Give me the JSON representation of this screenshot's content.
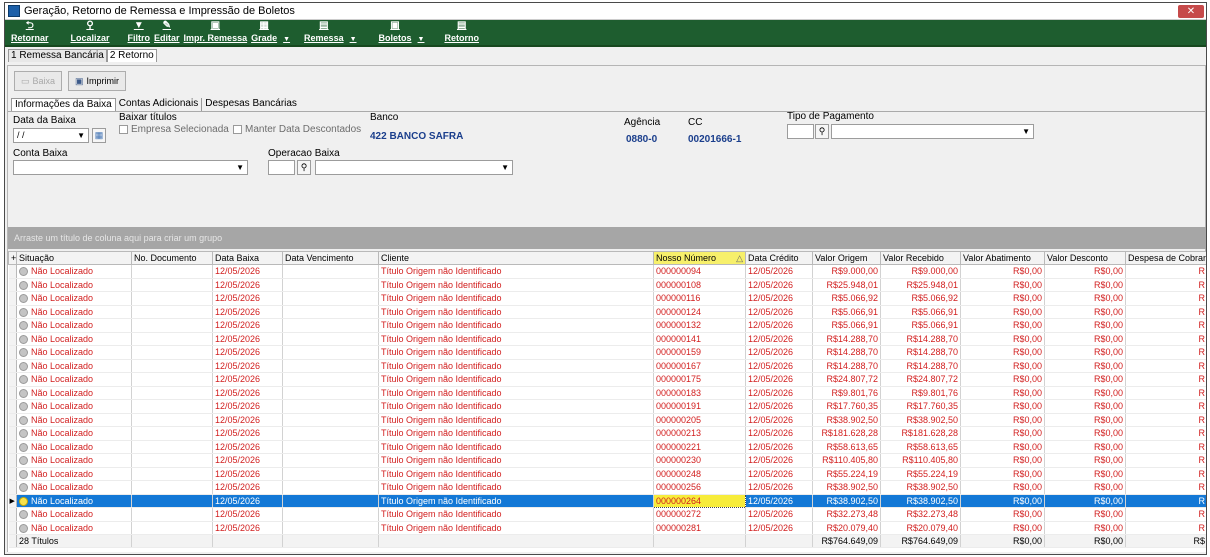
{
  "window": {
    "title": "Geração, Retorno de Remessa e Impressão de Boletos",
    "close": "✕"
  },
  "toolbar": {
    "retornar": "Retornar",
    "localizar": "Localizar",
    "filtro": "Filtro",
    "editar": "Editar",
    "impr_remessa": "Impr. Remessa",
    "grade": "Grade",
    "remessa": "Remessa",
    "boletos": "Boletos",
    "retorno": "Retorno"
  },
  "main_tabs": [
    "1 Remessa Bancária",
    "2 Retorno"
  ],
  "buttons": {
    "baixa": "Baixa",
    "imprimir": "Imprimir"
  },
  "sub_tabs": [
    "Informações da Baixa",
    "Contas Adicionais",
    "Despesas Bancárias"
  ],
  "form": {
    "data_baixa_label": "Data da Baixa",
    "data_baixa_value": " / /",
    "baixar_titulos_label": "Baixar títulos",
    "empresa_selecionada": "Empresa Selecionada",
    "manter_data": "Manter Data Descontados",
    "banco_label": "Banco",
    "banco_value": "422 BANCO SAFRA",
    "agencia_label": "Agência",
    "agencia_value": "0880-0",
    "cc_label": "CC",
    "cc_value": "00201666-1",
    "tipo_pagamento_label": "Tipo de Pagamento",
    "conta_baixa_label": "Conta Baixa",
    "operacao_baixa_label": "Operacao Baixa"
  },
  "group_area_text": "Arraste um título de coluna aqui para criar um grupo",
  "grid": {
    "columns": [
      "Situação",
      "No. Documento",
      "Data Baixa",
      "Data Vencimento",
      "Cliente",
      "Nosso Número",
      "Data Crédito",
      "Valor Origem",
      "Valor Recebido",
      "Valor Abatimento",
      "Valor Desconto",
      "Despesa de Cobrança"
    ],
    "sort_indicator": "△",
    "rows": [
      {
        "situacao": "Não Localizado",
        "doc": "",
        "data_baixa": "12/05/2026",
        "venc": "",
        "cliente": "Título Origem não Identificado",
        "nosso": "000000094",
        "credito": "12/05/2026",
        "origem": "R$9.000,00",
        "recebido": "R$9.000,00",
        "abat": "R$0,00",
        "desc": "R$0,00",
        "desp": "R"
      },
      {
        "situacao": "Não Localizado",
        "doc": "",
        "data_baixa": "12/05/2026",
        "venc": "",
        "cliente": "Título Origem não Identificado",
        "nosso": "000000108",
        "credito": "12/05/2026",
        "origem": "R$25.948,01",
        "recebido": "R$25.948,01",
        "abat": "R$0,00",
        "desc": "R$0,00",
        "desp": "R"
      },
      {
        "situacao": "Não Localizado",
        "doc": "",
        "data_baixa": "12/05/2026",
        "venc": "",
        "cliente": "Título Origem não Identificado",
        "nosso": "000000116",
        "credito": "12/05/2026",
        "origem": "R$5.066,92",
        "recebido": "R$5.066,92",
        "abat": "R$0,00",
        "desc": "R$0,00",
        "desp": "R"
      },
      {
        "situacao": "Não Localizado",
        "doc": "",
        "data_baixa": "12/05/2026",
        "venc": "",
        "cliente": "Título Origem não Identificado",
        "nosso": "000000124",
        "credito": "12/05/2026",
        "origem": "R$5.066,91",
        "recebido": "R$5.066,91",
        "abat": "R$0,00",
        "desc": "R$0,00",
        "desp": "R"
      },
      {
        "situacao": "Não Localizado",
        "doc": "",
        "data_baixa": "12/05/2026",
        "venc": "",
        "cliente": "Título Origem não Identificado",
        "nosso": "000000132",
        "credito": "12/05/2026",
        "origem": "R$5.066,91",
        "recebido": "R$5.066,91",
        "abat": "R$0,00",
        "desc": "R$0,00",
        "desp": "R"
      },
      {
        "situacao": "Não Localizado",
        "doc": "",
        "data_baixa": "12/05/2026",
        "venc": "",
        "cliente": "Título Origem não Identificado",
        "nosso": "000000141",
        "credito": "12/05/2026",
        "origem": "R$14.288,70",
        "recebido": "R$14.288,70",
        "abat": "R$0,00",
        "desc": "R$0,00",
        "desp": "R"
      },
      {
        "situacao": "Não Localizado",
        "doc": "",
        "data_baixa": "12/05/2026",
        "venc": "",
        "cliente": "Título Origem não Identificado",
        "nosso": "000000159",
        "credito": "12/05/2026",
        "origem": "R$14.288,70",
        "recebido": "R$14.288,70",
        "abat": "R$0,00",
        "desc": "R$0,00",
        "desp": "R"
      },
      {
        "situacao": "Não Localizado",
        "doc": "",
        "data_baixa": "12/05/2026",
        "venc": "",
        "cliente": "Título Origem não Identificado",
        "nosso": "000000167",
        "credito": "12/05/2026",
        "origem": "R$14.288,70",
        "recebido": "R$14.288,70",
        "abat": "R$0,00",
        "desc": "R$0,00",
        "desp": "R"
      },
      {
        "situacao": "Não Localizado",
        "doc": "",
        "data_baixa": "12/05/2026",
        "venc": "",
        "cliente": "Título Origem não Identificado",
        "nosso": "000000175",
        "credito": "12/05/2026",
        "origem": "R$24.807,72",
        "recebido": "R$24.807,72",
        "abat": "R$0,00",
        "desc": "R$0,00",
        "desp": "R"
      },
      {
        "situacao": "Não Localizado",
        "doc": "",
        "data_baixa": "12/05/2026",
        "venc": "",
        "cliente": "Título Origem não Identificado",
        "nosso": "000000183",
        "credito": "12/05/2026",
        "origem": "R$9.801,76",
        "recebido": "R$9.801,76",
        "abat": "R$0,00",
        "desc": "R$0,00",
        "desp": "R"
      },
      {
        "situacao": "Não Localizado",
        "doc": "",
        "data_baixa": "12/05/2026",
        "venc": "",
        "cliente": "Título Origem não Identificado",
        "nosso": "000000191",
        "credito": "12/05/2026",
        "origem": "R$17.760,35",
        "recebido": "R$17.760,35",
        "abat": "R$0,00",
        "desc": "R$0,00",
        "desp": "R"
      },
      {
        "situacao": "Não Localizado",
        "doc": "",
        "data_baixa": "12/05/2026",
        "venc": "",
        "cliente": "Título Origem não Identificado",
        "nosso": "000000205",
        "credito": "12/05/2026",
        "origem": "R$38.902,50",
        "recebido": "R$38.902,50",
        "abat": "R$0,00",
        "desc": "R$0,00",
        "desp": "R"
      },
      {
        "situacao": "Não Localizado",
        "doc": "",
        "data_baixa": "12/05/2026",
        "venc": "",
        "cliente": "Título Origem não Identificado",
        "nosso": "000000213",
        "credito": "12/05/2026",
        "origem": "R$181.628,28",
        "recebido": "R$181.628,28",
        "abat": "R$0,00",
        "desc": "R$0,00",
        "desp": "R"
      },
      {
        "situacao": "Não Localizado",
        "doc": "",
        "data_baixa": "12/05/2026",
        "venc": "",
        "cliente": "Título Origem não Identificado",
        "nosso": "000000221",
        "credito": "12/05/2026",
        "origem": "R$58.613,65",
        "recebido": "R$58.613,65",
        "abat": "R$0,00",
        "desc": "R$0,00",
        "desp": "R"
      },
      {
        "situacao": "Não Localizado",
        "doc": "",
        "data_baixa": "12/05/2026",
        "venc": "",
        "cliente": "Título Origem não Identificado",
        "nosso": "000000230",
        "credito": "12/05/2026",
        "origem": "R$110.405,80",
        "recebido": "R$110.405,80",
        "abat": "R$0,00",
        "desc": "R$0,00",
        "desp": "R"
      },
      {
        "situacao": "Não Localizado",
        "doc": "",
        "data_baixa": "12/05/2026",
        "venc": "",
        "cliente": "Título Origem não Identificado",
        "nosso": "000000248",
        "credito": "12/05/2026",
        "origem": "R$55.224,19",
        "recebido": "R$55.224,19",
        "abat": "R$0,00",
        "desc": "R$0,00",
        "desp": "R"
      },
      {
        "situacao": "Não Localizado",
        "doc": "",
        "data_baixa": "12/05/2026",
        "venc": "",
        "cliente": "Título Origem não Identificado",
        "nosso": "000000256",
        "credito": "12/05/2026",
        "origem": "R$38.902,50",
        "recebido": "R$38.902,50",
        "abat": "R$0,00",
        "desc": "R$0,00",
        "desp": "R"
      },
      {
        "situacao": "Não Localizado",
        "doc": "",
        "data_baixa": "12/05/2026",
        "venc": "",
        "cliente": "Título Origem não Identificado",
        "nosso": "000000264",
        "credito": "12/05/2026",
        "origem": "R$38.902,50",
        "recebido": "R$38.902,50",
        "abat": "R$0,00",
        "desc": "R$0,00",
        "desp": "R",
        "selected": true
      },
      {
        "situacao": "Não Localizado",
        "doc": "",
        "data_baixa": "12/05/2026",
        "venc": "",
        "cliente": "Título Origem não Identificado",
        "nosso": "000000272",
        "credito": "12/05/2026",
        "origem": "R$32.273,48",
        "recebido": "R$32.273,48",
        "abat": "R$0,00",
        "desc": "R$0,00",
        "desp": "R"
      },
      {
        "situacao": "Não Localizado",
        "doc": "",
        "data_baixa": "12/05/2026",
        "venc": "",
        "cliente": "Título Origem não Identificado",
        "nosso": "000000281",
        "credito": "12/05/2026",
        "origem": "R$20.079,40",
        "recebido": "R$20.079,40",
        "abat": "R$0,00",
        "desc": "R$0,00",
        "desp": "R"
      }
    ],
    "footer": {
      "count": "28 Títulos",
      "origem": "R$764.649,09",
      "recebido": "R$764.649,09",
      "abat": "R$0,00",
      "desc": "R$0,00",
      "desp": "R$"
    }
  },
  "colors": {
    "toolbar": "#1e5d2f",
    "selected_row": "#1378d6",
    "highlight": "#f7f06b",
    "text_red": "#d21e1e",
    "value_blue": "#1a3e8c"
  }
}
